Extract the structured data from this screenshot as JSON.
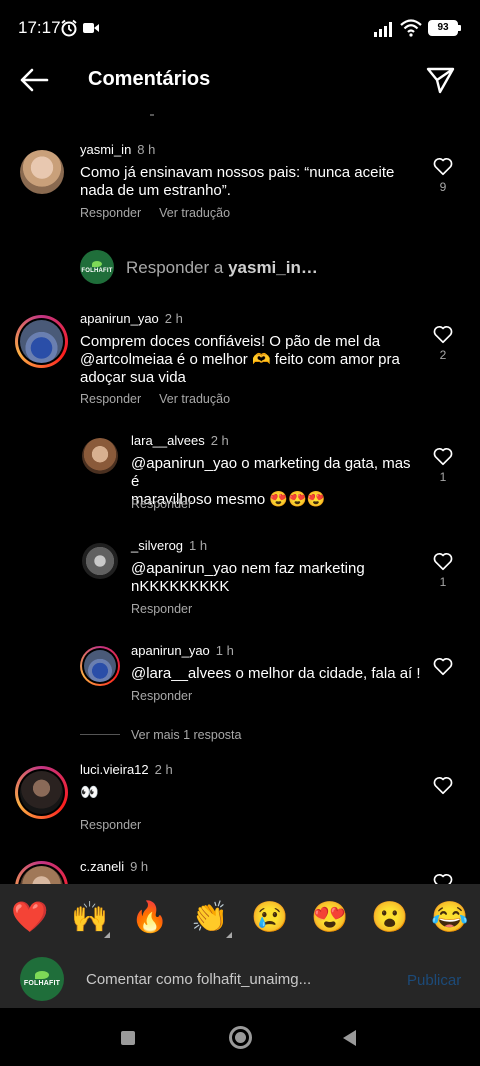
{
  "status_bar": {
    "time": "17:17",
    "battery": "93"
  },
  "header": {
    "title": "Comentários"
  },
  "comments": [
    {
      "user": "yasmi_in",
      "time": "8 h",
      "text_l1": "Como já ensinavam nossos pais: “nunca aceite",
      "text_l2": "nada de um estranho”.",
      "reply": "Responder",
      "translate": "Ver tradução",
      "likes": "9"
    },
    {
      "user": "apanirun_yao",
      "time": "2 h",
      "text_l1": "Comprem doces confiáveis! O pão de mel da",
      "text_l2": "@artcolmeiaa é o melhor 🫶 feito com amor pra",
      "text_l3": "adoçar sua vida",
      "reply": "Responder",
      "translate": "Ver tradução",
      "likes": "2"
    }
  ],
  "reply_prompt": {
    "prefix": "Responder a ",
    "user": "yasmi_in…"
  },
  "replies": [
    {
      "user": "lara__alvees",
      "time": "2 h",
      "text_l1": "@apanirun_yao o marketing da gata, mas é",
      "text_l2": "maravilhoso mesmo 😍😍😍",
      "reply": "Responder",
      "likes": "1"
    },
    {
      "user": "_silverog",
      "time": "1 h",
      "text_l1": "@apanirun_yao nem faz marketing",
      "text_l2": "nKKKKKKKKK",
      "reply": "Responder",
      "likes": "1"
    },
    {
      "user": "apanirun_yao",
      "time": "1 h",
      "text_l1": "@lara__alvees o melhor da cidade, fala aí !",
      "reply": "Responder"
    }
  ],
  "more_replies": "Ver mais 1 resposta",
  "comment3": {
    "user": "luci.vieira12",
    "time": "2 h",
    "text": "👀",
    "reply": "Responder"
  },
  "comment4": {
    "user": "c.zaneli",
    "time": "9 h"
  },
  "emojis": [
    "❤️",
    "🙌",
    "🔥",
    "👏",
    "😢",
    "😍",
    "😮",
    "😂"
  ],
  "input": {
    "placeholder": "Comentar como folhafit_unaimg...",
    "publish": "Publicar"
  },
  "logo_text": "FOLHAFIT",
  "colors": {
    "background": "#000000",
    "secondary_text": "#a8a8a8",
    "publish": "#1c4a78",
    "bar": "#262626"
  }
}
